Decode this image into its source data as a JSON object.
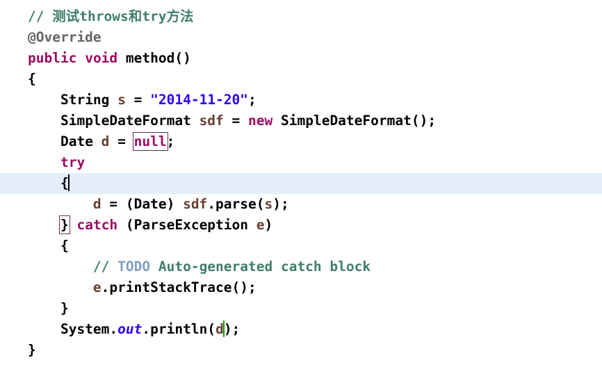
{
  "editor": {
    "language": "Java",
    "background_color": "#ffffff",
    "current_line_highlight_color": "#e4eefb",
    "caret_color": "#000000",
    "secondary_caret_color": "#10a010",
    "colors": {
      "keyword": "#9b0a63",
      "comment": "#3f7f68",
      "todo_tag": "#7f9fbf",
      "annotation": "#646464",
      "string": "#2a00ff",
      "local_variable": "#6a3e33",
      "static_field": "#2a00ff",
      "plain": "#000000",
      "occurrence_box_border": "#5c2d56",
      "bracket_match_box_border": "#702a5a"
    },
    "lines": [
      {
        "n": 1,
        "indent": 0,
        "current": false,
        "tokens": [
          {
            "t": "// ",
            "c": "comment"
          },
          {
            "t": "测试",
            "c": "comment",
            "cjk": true
          },
          {
            "t": "throws",
            "c": "comment"
          },
          {
            "t": "和",
            "c": "comment",
            "cjk": true
          },
          {
            "t": "try",
            "c": "comment"
          },
          {
            "t": "方法",
            "c": "comment",
            "cjk": true
          }
        ]
      },
      {
        "n": 2,
        "indent": 0,
        "current": false,
        "tokens": [
          {
            "t": "@Override",
            "c": "annot"
          }
        ]
      },
      {
        "n": 3,
        "indent": 0,
        "current": false,
        "tokens": [
          {
            "t": "public",
            "c": "keyword"
          },
          {
            "t": " ",
            "c": "plain"
          },
          {
            "t": "void",
            "c": "keyword"
          },
          {
            "t": " method()",
            "c": "plain"
          }
        ]
      },
      {
        "n": 4,
        "indent": 0,
        "current": false,
        "tokens": [
          {
            "t": "{",
            "c": "plain"
          }
        ]
      },
      {
        "n": 5,
        "indent": 1,
        "current": false,
        "tokens": [
          {
            "t": "String ",
            "c": "plain"
          },
          {
            "t": "s",
            "c": "local"
          },
          {
            "t": " = ",
            "c": "plain"
          },
          {
            "t": "\"2014-11-20\"",
            "c": "string"
          },
          {
            "t": ";",
            "c": "plain"
          }
        ]
      },
      {
        "n": 6,
        "indent": 1,
        "current": false,
        "tokens": [
          {
            "t": "SimpleDateFormat ",
            "c": "plain"
          },
          {
            "t": "sdf",
            "c": "local"
          },
          {
            "t": " = ",
            "c": "plain"
          },
          {
            "t": "new",
            "c": "keyword"
          },
          {
            "t": " SimpleDateFormat();",
            "c": "plain"
          }
        ]
      },
      {
        "n": 7,
        "indent": 1,
        "current": false,
        "tokens": [
          {
            "t": "Date ",
            "c": "plain"
          },
          {
            "t": "d",
            "c": "local"
          },
          {
            "t": " = ",
            "c": "plain"
          },
          {
            "t": "null",
            "c": "keyword",
            "box": "occurrence"
          },
          {
            "t": ";",
            "c": "plain"
          }
        ]
      },
      {
        "n": 8,
        "indent": 1,
        "current": false,
        "tokens": [
          {
            "t": "try",
            "c": "keyword"
          }
        ]
      },
      {
        "n": 9,
        "indent": 1,
        "current": true,
        "tokens": [
          {
            "t": "{",
            "c": "plain"
          },
          {
            "t": "",
            "c": "plain",
            "caret": "primary"
          }
        ]
      },
      {
        "n": 10,
        "indent": 2,
        "current": false,
        "tokens": [
          {
            "t": "d",
            "c": "local"
          },
          {
            "t": " = (Date) ",
            "c": "plain"
          },
          {
            "t": "sdf",
            "c": "local"
          },
          {
            "t": ".parse(",
            "c": "plain"
          },
          {
            "t": "s",
            "c": "local"
          },
          {
            "t": ");",
            "c": "plain"
          }
        ]
      },
      {
        "n": 11,
        "indent": 1,
        "current": false,
        "tokens": [
          {
            "t": "}",
            "c": "plain",
            "box": "bracket"
          },
          {
            "t": " ",
            "c": "plain"
          },
          {
            "t": "catch",
            "c": "keyword"
          },
          {
            "t": " (ParseException ",
            "c": "plain"
          },
          {
            "t": "e",
            "c": "local"
          },
          {
            "t": ")",
            "c": "plain"
          }
        ]
      },
      {
        "n": 12,
        "indent": 1,
        "current": false,
        "tokens": [
          {
            "t": "{",
            "c": "plain"
          }
        ]
      },
      {
        "n": 13,
        "indent": 2,
        "current": false,
        "tokens": [
          {
            "t": "// ",
            "c": "comment"
          },
          {
            "t": "TODO",
            "c": "todo"
          },
          {
            "t": " Auto-generated catch block",
            "c": "comment"
          }
        ]
      },
      {
        "n": 14,
        "indent": 2,
        "current": false,
        "tokens": [
          {
            "t": "e",
            "c": "local"
          },
          {
            "t": ".printStackTrace();",
            "c": "plain"
          }
        ]
      },
      {
        "n": 15,
        "indent": 1,
        "current": false,
        "tokens": [
          {
            "t": "}",
            "c": "plain"
          }
        ]
      },
      {
        "n": 16,
        "indent": 1,
        "current": false,
        "tokens": [
          {
            "t": "System.",
            "c": "plain"
          },
          {
            "t": "out",
            "c": "static"
          },
          {
            "t": ".println(",
            "c": "plain"
          },
          {
            "t": "d",
            "c": "local"
          },
          {
            "t": "",
            "c": "plain",
            "caret": "green"
          },
          {
            "t": ");",
            "c": "plain"
          }
        ]
      },
      {
        "n": 17,
        "indent": 0,
        "current": false,
        "tokens": [
          {
            "t": "}",
            "c": "plain"
          }
        ]
      }
    ]
  }
}
